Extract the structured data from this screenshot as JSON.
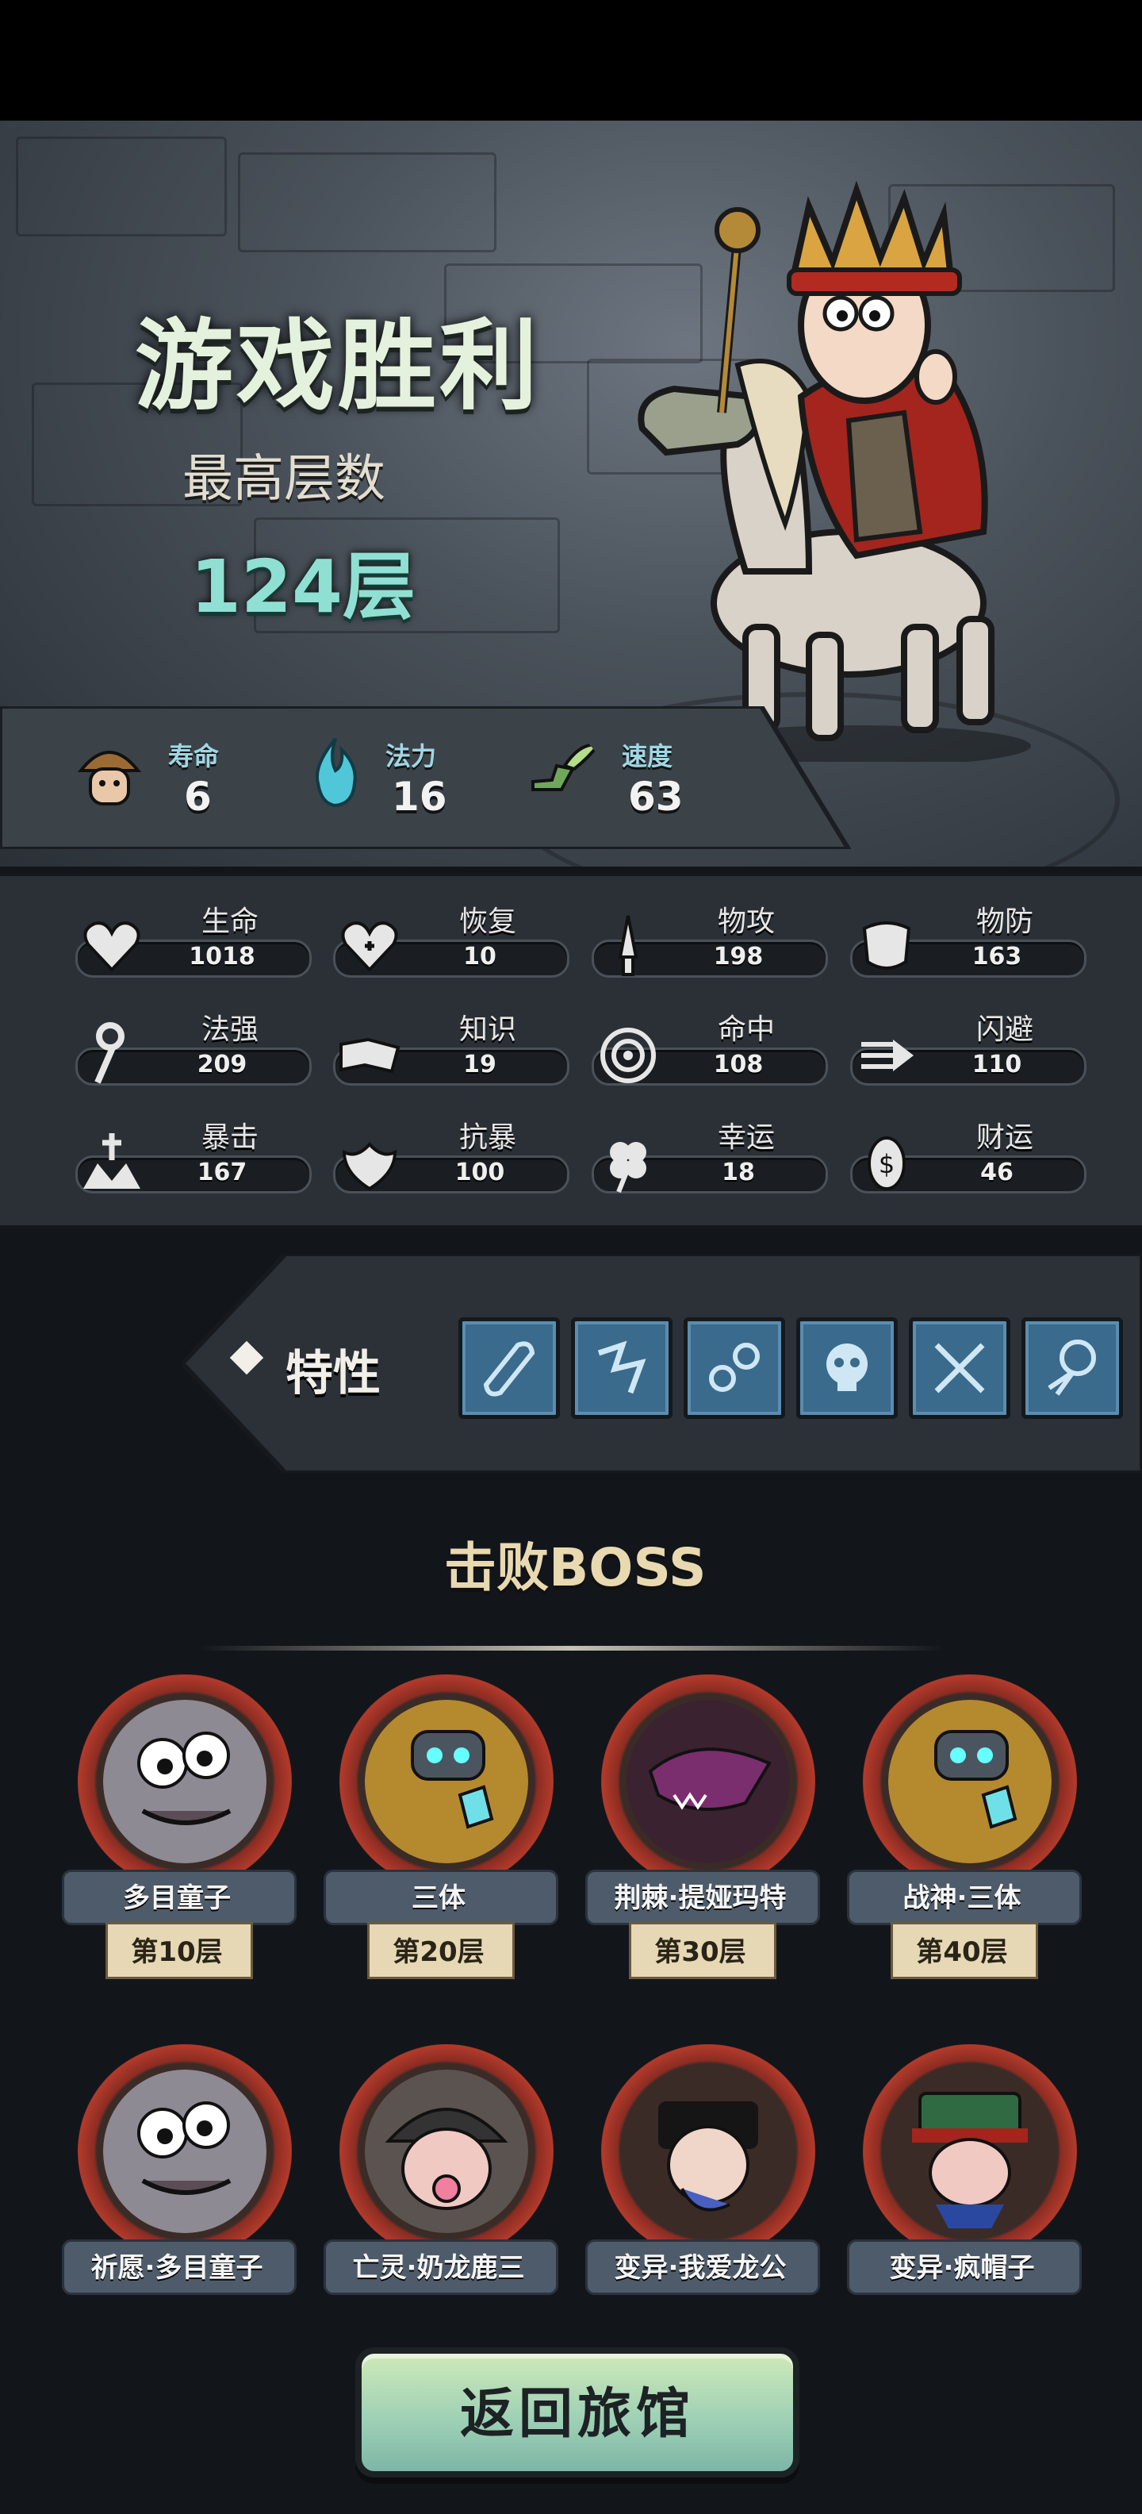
{
  "result": {
    "title": "游戏胜利",
    "subtitle": "最高层数",
    "floor_count": "124层"
  },
  "resources": [
    {
      "label": "寿命",
      "value": "6",
      "icon": "shroom-face-icon"
    },
    {
      "label": "法力",
      "value": "16",
      "icon": "blue-flame-icon"
    },
    {
      "label": "速度",
      "value": "63",
      "icon": "winged-boot-icon"
    }
  ],
  "stats": [
    {
      "label": "生命",
      "value": "1018",
      "icon": "heart-icon"
    },
    {
      "label": "恢复",
      "value": "10",
      "icon": "heart-plus-icon"
    },
    {
      "label": "物攻",
      "value": "198",
      "icon": "sword-icon"
    },
    {
      "label": "物防",
      "value": "163",
      "icon": "armor-icon"
    },
    {
      "label": "法强",
      "value": "209",
      "icon": "staff-icon"
    },
    {
      "label": "知识",
      "value": "19",
      "icon": "book-icon"
    },
    {
      "label": "命中",
      "value": "108",
      "icon": "target-icon"
    },
    {
      "label": "闪避",
      "value": "110",
      "icon": "dash-arrow-icon"
    },
    {
      "label": "暴击",
      "value": "167",
      "icon": "crit-burst-icon"
    },
    {
      "label": "抗暴",
      "value": "100",
      "icon": "shield-flower-icon"
    },
    {
      "label": "幸运",
      "value": "18",
      "icon": "clover-icon"
    },
    {
      "label": "财运",
      "value": "46",
      "icon": "coin-icon"
    }
  ],
  "traits": {
    "label": "特性",
    "items": [
      "scroll-icon",
      "rune-icon",
      "chain-icon",
      "skull-icon",
      "swords-icon",
      "bird-icon"
    ]
  },
  "bosses": {
    "title": "击败BOSS",
    "items": [
      {
        "name": "多目童子",
        "floor": "第10层"
      },
      {
        "name": "三体",
        "floor": "第20层"
      },
      {
        "name": "荆棘·提娅玛特",
        "floor": "第30层"
      },
      {
        "name": "战神·三体",
        "floor": "第40层"
      },
      {
        "name": "祈愿·多目童子"
      },
      {
        "name": "亡灵·奶龙鹿三"
      },
      {
        "name": "变异·我爱龙公"
      },
      {
        "name": "变异·疯帽子"
      }
    ]
  },
  "return_button": "返回旅馆",
  "colors": {
    "title": "#e4f1dc",
    "floor_count": "#8fe0d2",
    "trait_tile": "#3a6a8c",
    "boss_frame": "#b13a2b",
    "button": "#9fd1b6"
  }
}
